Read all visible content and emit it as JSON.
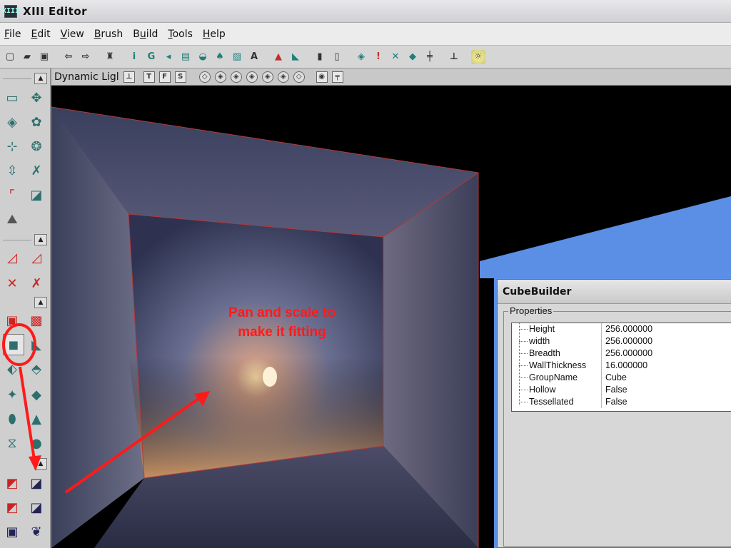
{
  "window": {
    "title": "XIII Editor",
    "icon_text": "XIII"
  },
  "menu": [
    {
      "label": "File",
      "key": "F",
      "rest": "ile"
    },
    {
      "label": "Edit",
      "key": "E",
      "rest": "dit"
    },
    {
      "label": "View",
      "key": "V",
      "rest": "iew"
    },
    {
      "label": "Brush",
      "key": "B",
      "rest": "rush"
    },
    {
      "label": "Build",
      "key": "u",
      "pre": "B",
      "rest": "ild"
    },
    {
      "label": "Tools",
      "key": "T",
      "rest": "ools"
    },
    {
      "label": "Help",
      "key": "H",
      "rest": "elp"
    }
  ],
  "toolbar": {
    "glyphs": {
      "new": "🗋",
      "open": "📂",
      "save": "💾",
      "undo": "⇦",
      "redo": "⇨",
      "find": "🔍",
      "info": "ℹ",
      "g": "G",
      "a": "A"
    }
  },
  "viewport": {
    "label": "Dynamic Ligl",
    "view_buttons": [
      "T",
      "F",
      "S"
    ]
  },
  "annotation": {
    "text_line1": "Pan and scale to",
    "text_line2": "make it fitting",
    "color": "#ff1a1a"
  },
  "dialog": {
    "title": "CubeBuilder",
    "group_label": "Properties",
    "properties": [
      {
        "name": "Height",
        "value": "256.000000"
      },
      {
        "name": "width",
        "value": "256.000000"
      },
      {
        "name": "Breadth",
        "value": "256.000000"
      },
      {
        "name": "WallThickness",
        "value": "16.000000"
      },
      {
        "name": "GroupName",
        "value": "Cube"
      },
      {
        "name": "Hollow",
        "value": "False"
      },
      {
        "name": "Tessellated",
        "value": "False"
      }
    ]
  },
  "colors": {
    "annotation_red": "#ff1a1a",
    "sky_blue": "#5b8fe6",
    "toolbar_teal": "#1f7f7a"
  }
}
